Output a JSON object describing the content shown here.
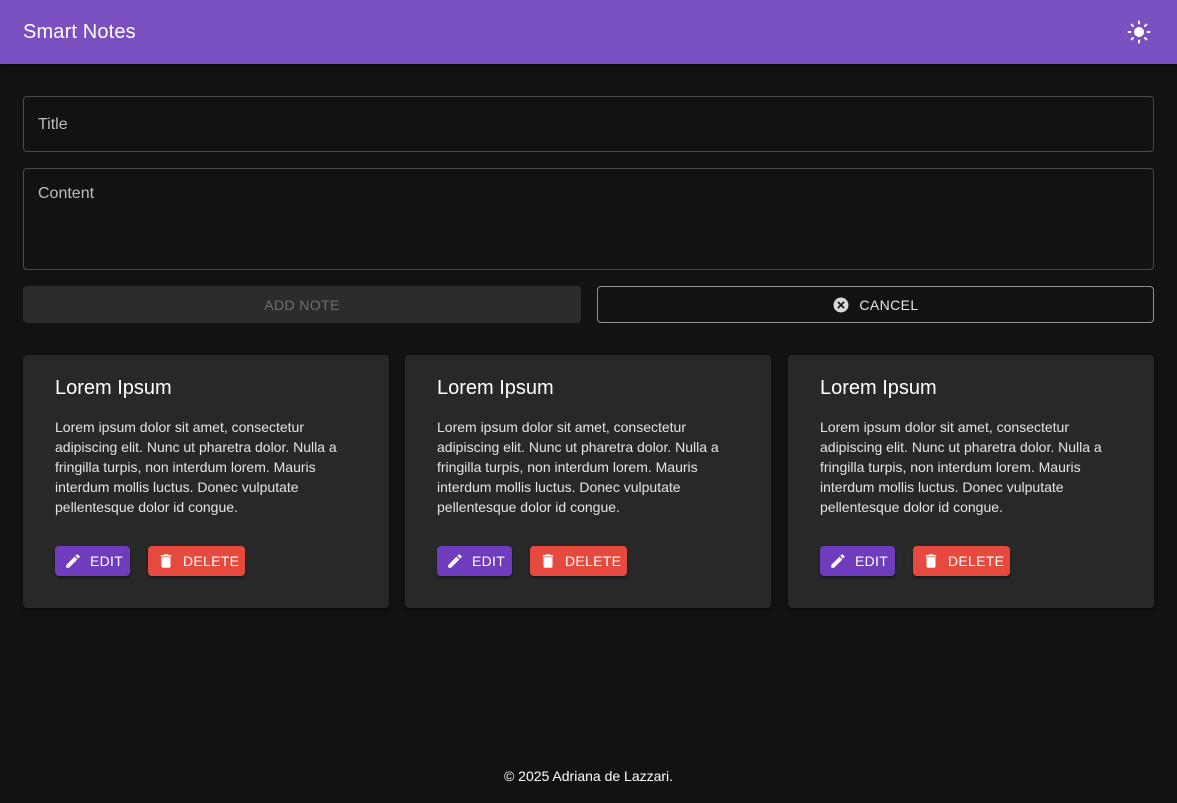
{
  "app": {
    "title": "Smart Notes",
    "theme_icon": "sun-icon",
    "colors": {
      "appbar": "#7a4fc0",
      "background": "#121212",
      "card": "#282828",
      "edit": "#6e3cbc",
      "delete": "#e64a3f"
    }
  },
  "form": {
    "title_placeholder": "Title",
    "content_placeholder": "Content",
    "add_label": "ADD NOTE",
    "cancel_label": "CANCEL",
    "cancel_icon": "close-circle-icon"
  },
  "notes": [
    {
      "title": "Lorem Ipsum",
      "content": "Lorem ipsum dolor sit amet, consectetur adipiscing elit. Nunc ut pharetra dolor. Nulla a fringilla turpis, non interdum lorem. Mauris interdum mollis luctus. Donec vulputate pellentesque dolor id congue.",
      "edit_label": "EDIT",
      "delete_label": "DELETE"
    },
    {
      "title": "Lorem Ipsum",
      "content": "Lorem ipsum dolor sit amet, consectetur adipiscing elit. Nunc ut pharetra dolor. Nulla a fringilla turpis, non interdum lorem. Mauris interdum mollis luctus. Donec vulputate pellentesque dolor id congue.",
      "edit_label": "EDIT",
      "delete_label": "DELETE"
    },
    {
      "title": "Lorem Ipsum",
      "content": "Lorem ipsum dolor sit amet, consectetur adipiscing elit. Nunc ut pharetra dolor. Nulla a fringilla turpis, non interdum lorem. Mauris interdum mollis luctus. Donec vulputate pellentesque dolor id congue.",
      "edit_label": "EDIT",
      "delete_label": "DELETE"
    }
  ],
  "footer": {
    "text": "© 2025 Adriana de Lazzari."
  }
}
